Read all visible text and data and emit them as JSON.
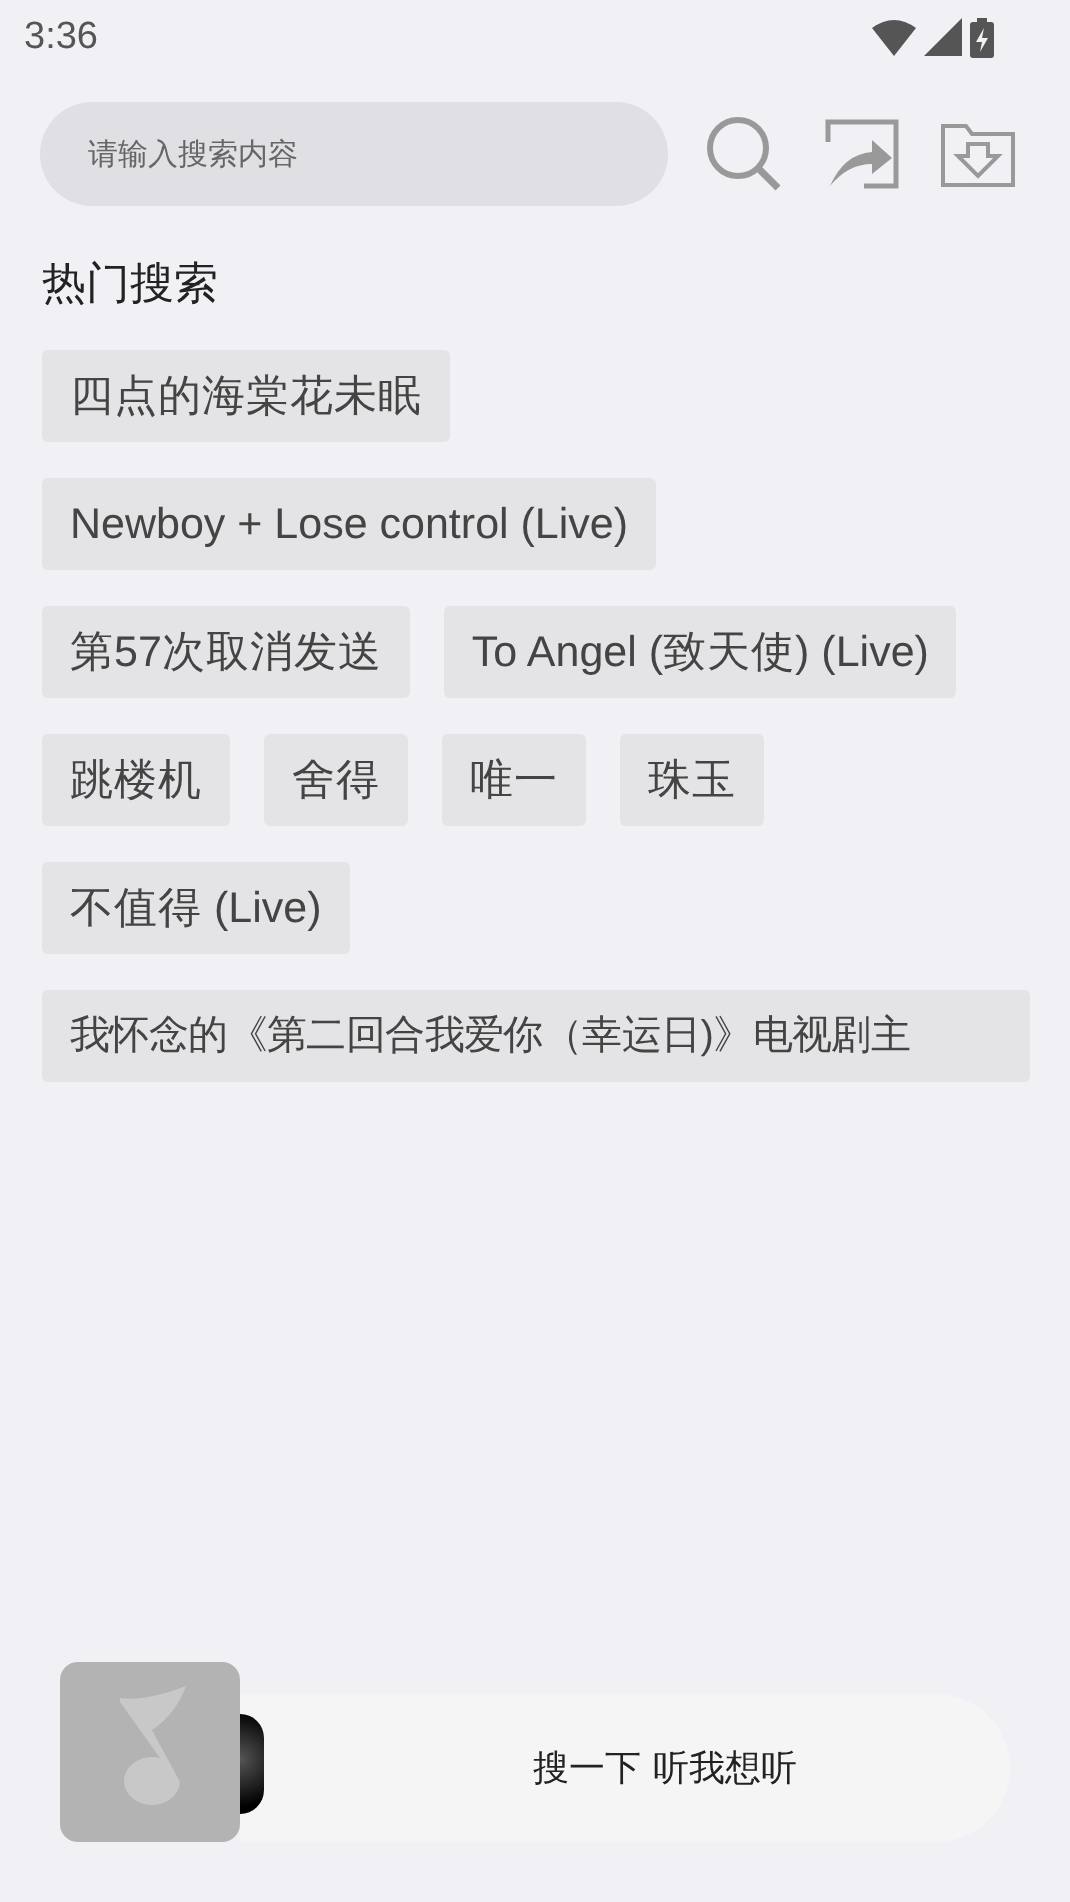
{
  "status_bar": {
    "time": "3:36"
  },
  "search": {
    "placeholder": "请输入搜索内容"
  },
  "hot_search": {
    "title": "热门搜索",
    "tags": [
      "四点的海棠花未眠",
      "Newboy + Lose control (Live)",
      "第57次取消发送",
      "To Angel (致天使) (Live)",
      "跳楼机",
      "舍得",
      "唯一",
      "珠玉",
      "不值得 (Live)",
      "我怀念的《第二回合我爱你（幸运日)》电视剧主"
    ]
  },
  "player": {
    "prompt": "搜一下 听我想听"
  }
}
